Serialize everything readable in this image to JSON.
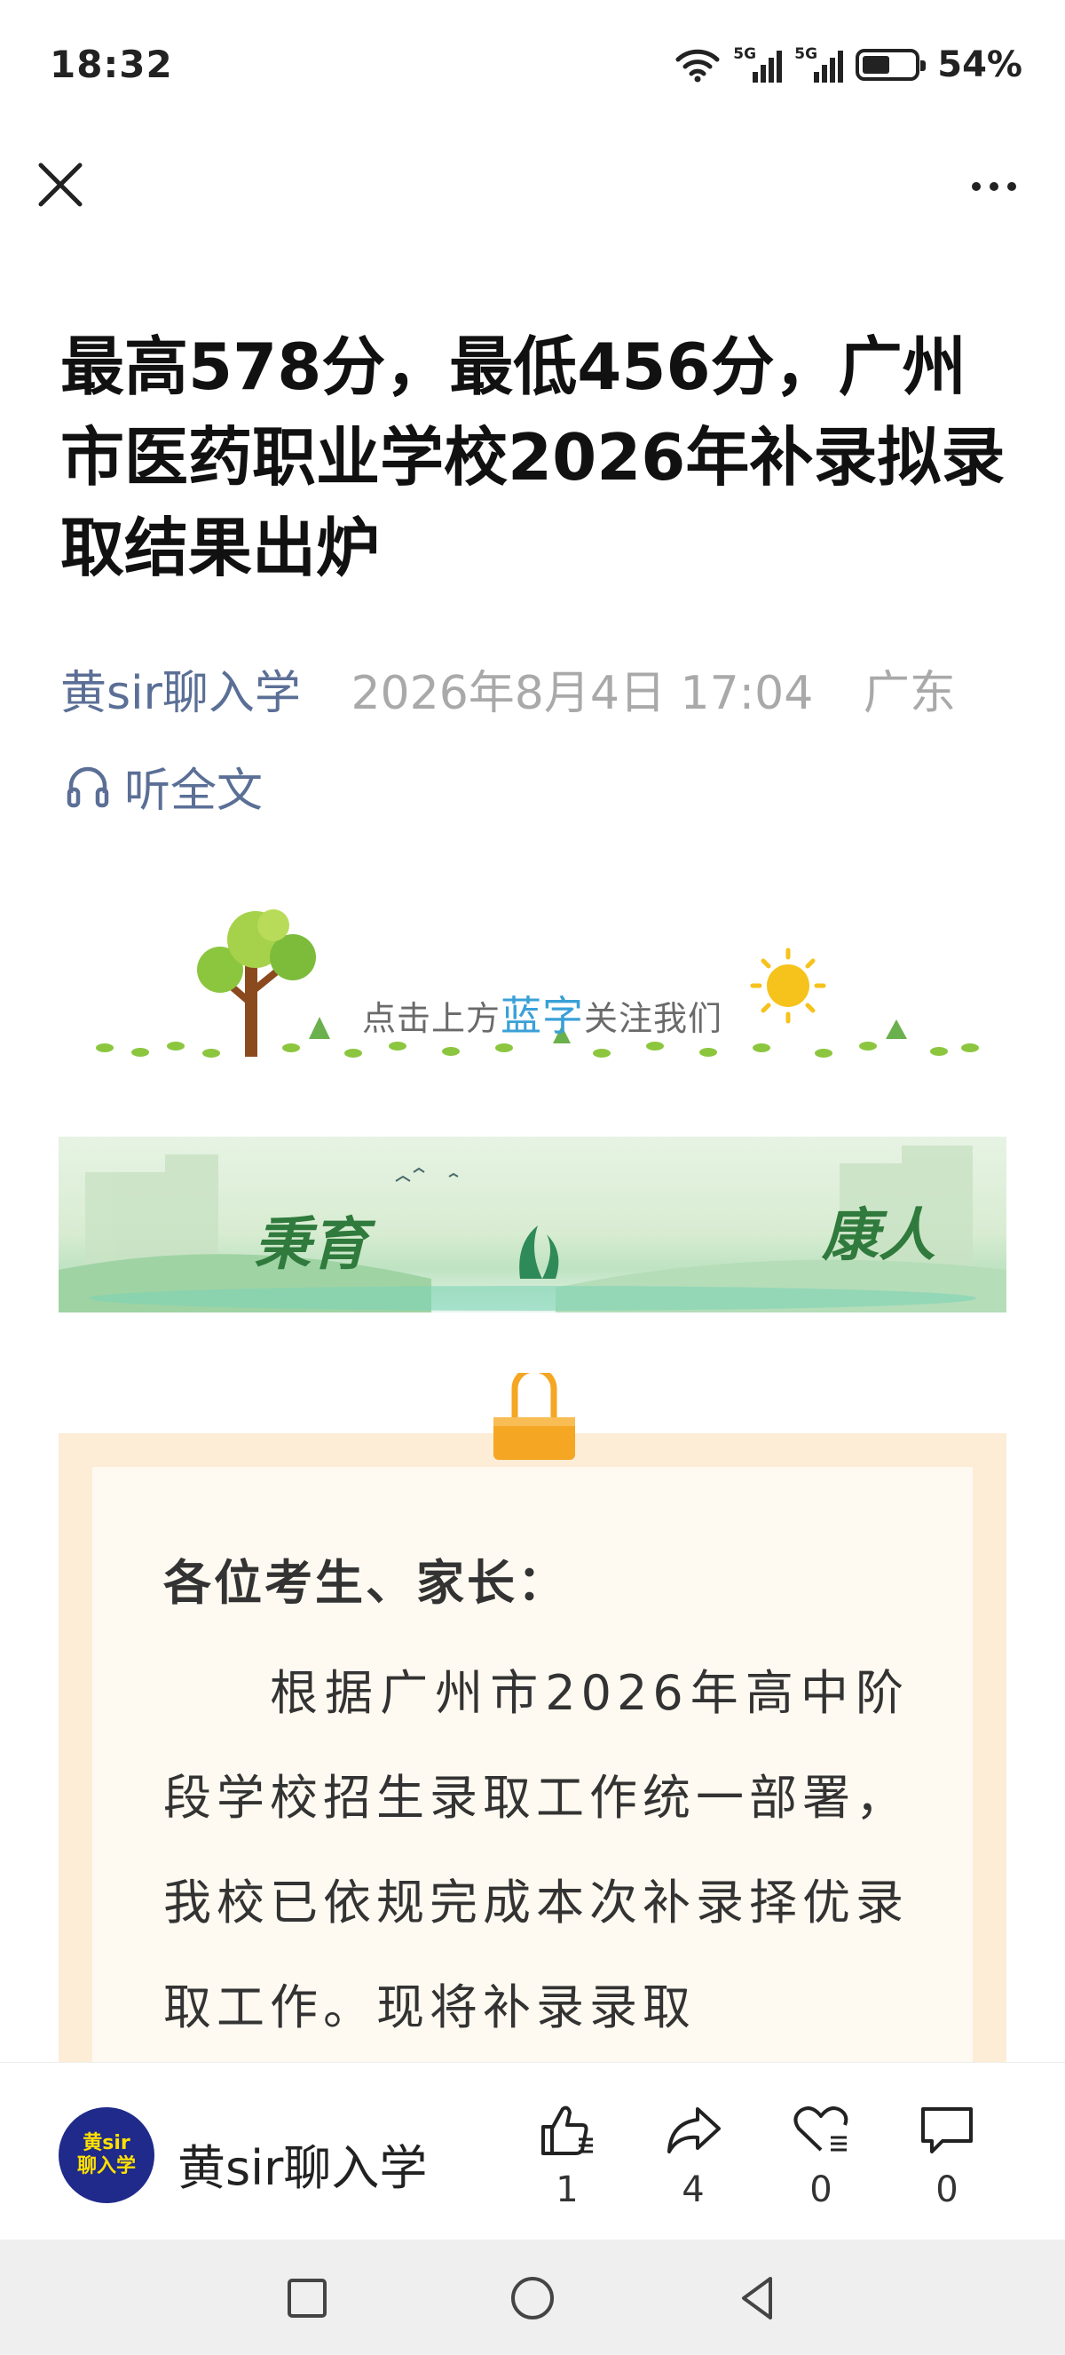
{
  "status_bar": {
    "time": "18:32",
    "signal1_label": "5G",
    "signal2_label": "5G",
    "battery_percent": "54%",
    "battery_level": 0.54
  },
  "article": {
    "title": "最高578分，最低456分，广州市医药职业学校2026年补录拟录取结果出炉",
    "author": "黄sir聊入学",
    "publish_time": "2026年8月4日 17:04",
    "location": "广东",
    "listen_label": "听全文"
  },
  "banner1": {
    "text_before": "点击上方",
    "text_highlight": "蓝字",
    "text_after": "关注我们"
  },
  "banner2": {
    "text_left": "秉育",
    "text_right": "康人"
  },
  "letter": {
    "greeting": "各位考生、家长：",
    "paragraph": "根据广州市2026年高中阶段学校招生录取工作统一部署，我校已依规完成本次补录择优录取工作。现将补录录取"
  },
  "action_bar": {
    "account_name": "黄sir聊入学",
    "avatar_line1": "黄sir",
    "avatar_line2": "聊入学",
    "like_count": "1",
    "share_count": "4",
    "favorite_count": "0",
    "comment_count": "0"
  },
  "icons": {
    "close": "close-icon",
    "more": "more-icon",
    "headphones": "headphones-icon",
    "like": "thumbs-up-icon",
    "share": "share-icon",
    "favorite": "heart-icon",
    "comment": "comment-icon",
    "nav_recent": "square-icon",
    "nav_home": "circle-icon",
    "nav_back": "triangle-back-icon"
  },
  "colors": {
    "author_link": "#5b6f96",
    "meta_gray": "#a9a9a9",
    "card_border": "#fdecd6",
    "card_bg": "#fffaf1",
    "clip_orange": "#f5a623",
    "avatar_bg": "#1f2a8a"
  }
}
